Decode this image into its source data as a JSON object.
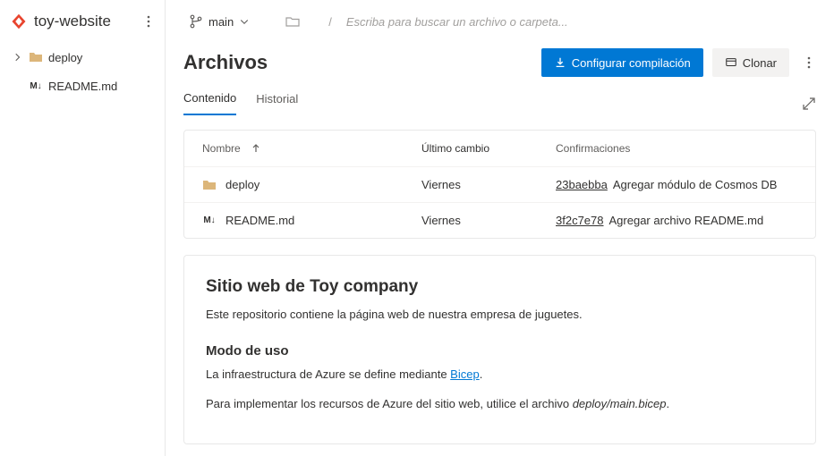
{
  "sidebar": {
    "repo_name": "toy-website",
    "tree": [
      {
        "type": "folder",
        "label": "deploy"
      },
      {
        "type": "file",
        "label": "README.md",
        "badge": "M↓"
      }
    ]
  },
  "topbar": {
    "branch": "main",
    "search_placeholder": "Escriba para buscar un archivo o carpeta..."
  },
  "header": {
    "title": "Archivos",
    "configure_build": "Configurar compilación",
    "clone": "Clonar"
  },
  "tabs": {
    "content": "Contenido",
    "history": "Historial"
  },
  "table": {
    "col_name": "Nombre",
    "col_change": "Último cambio",
    "col_commits": "Confirmaciones",
    "rows": [
      {
        "type": "folder",
        "name": "deploy",
        "badge": "",
        "change": "Viernes",
        "hash": "23baebba",
        "msg": "Agregar módulo de Cosmos DB"
      },
      {
        "type": "file",
        "name": "README.md",
        "badge": "M↓",
        "change": "Viernes",
        "hash": "3f2c7e78",
        "msg": "Agregar archivo README.md"
      }
    ]
  },
  "readme": {
    "h1": "Sitio web de Toy company",
    "p1": "Este repositorio contiene la página web de nuestra empresa de juguetes.",
    "h2": "Modo de uso",
    "p2a": "La infraestructura de Azure se define mediante ",
    "p2_link": "Bicep",
    "p2b": ".",
    "p3a": "Para implementar los recursos de Azure del sitio web, utilice el archivo ",
    "p3_em": "deploy/main.bicep",
    "p3b": "."
  }
}
